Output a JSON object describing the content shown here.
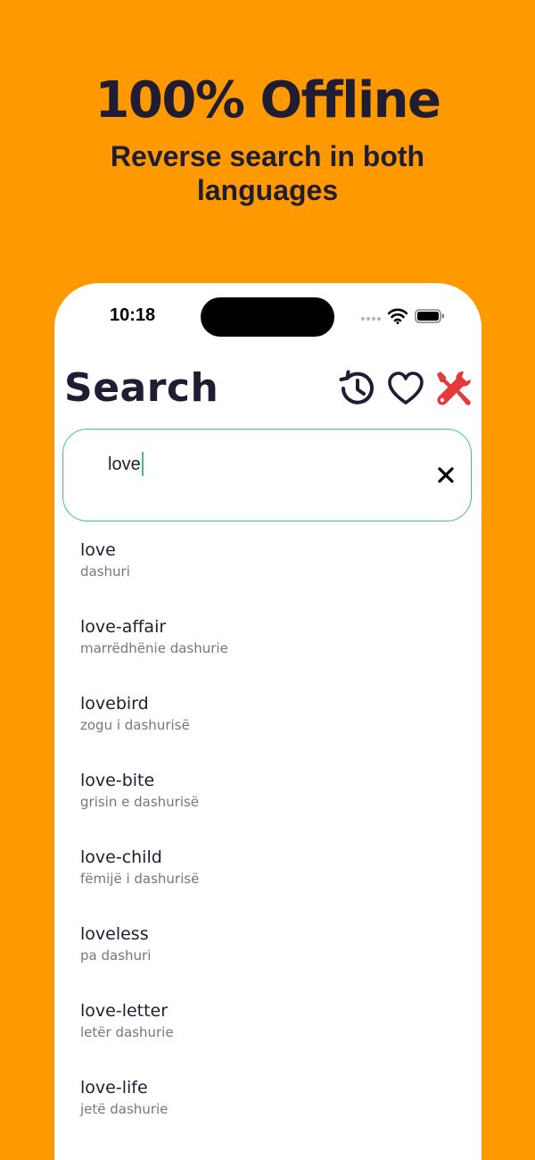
{
  "promo": {
    "headline": "100% Offline",
    "subline": "Reverse search in both languages"
  },
  "status_bar": {
    "time": "10:18",
    "icons": [
      "signal-icon",
      "wifi-icon",
      "battery-icon"
    ]
  },
  "header": {
    "title": "Search",
    "actions": [
      "history-icon",
      "heart-icon",
      "tools-icon"
    ]
  },
  "search": {
    "value": "love",
    "clear_icon": "close-icon"
  },
  "results": [
    {
      "term": "love",
      "translation": "dashuri"
    },
    {
      "term": "love-affair",
      "translation": "marrëdhënie dashurie"
    },
    {
      "term": "lovebird",
      "translation": "zogu i dashurisë"
    },
    {
      "term": "love-bite",
      "translation": "grisin e dashurisë"
    },
    {
      "term": "love-child",
      "translation": "fëmijë i dashurisë"
    },
    {
      "term": "loveless",
      "translation": "pa dashuri"
    },
    {
      "term": "love-letter",
      "translation": "letër dashurie"
    },
    {
      "term": "love-life",
      "translation": "jetë dashurie"
    }
  ],
  "colors": {
    "background": "#FE9A00",
    "text_dark": "#1f1d33",
    "accent_green": "#3ec28f",
    "tools_red": "#e5383b",
    "muted_text": "#77767d"
  }
}
